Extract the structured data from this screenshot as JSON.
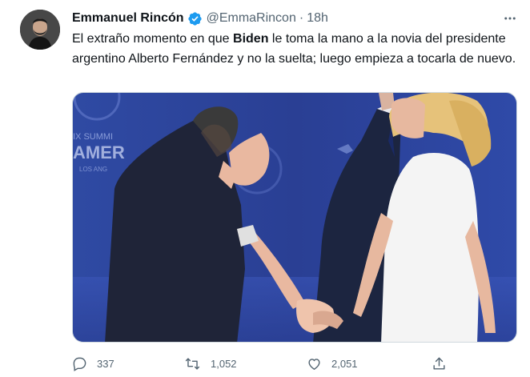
{
  "author": {
    "display_name": "Emmanuel Rincón",
    "handle": "@EmmaRincon",
    "separator": "·",
    "time": "18h"
  },
  "tweet": {
    "text_before": "El extraño momento en que ",
    "text_bold": "Biden",
    "text_after": " le toma la mano a la novia del presidente argentino Alberto Fernández y no la suelta; luego empieza a tocarla de nuevo."
  },
  "media": {
    "banner_text_line1": "IX SUMMI",
    "banner_text_line2": "AMER",
    "banner_text_line3": "LOS ANG"
  },
  "actions": {
    "replies": "337",
    "retweets": "1,052",
    "likes": "2,051"
  },
  "colors": {
    "verified": "#1d9bf0",
    "secondary_text": "#536471",
    "stage_blue": "#2b3f93"
  },
  "icons": [
    "verified-badge-icon",
    "more-icon",
    "reply-icon",
    "retweet-icon",
    "like-icon",
    "share-icon"
  ]
}
